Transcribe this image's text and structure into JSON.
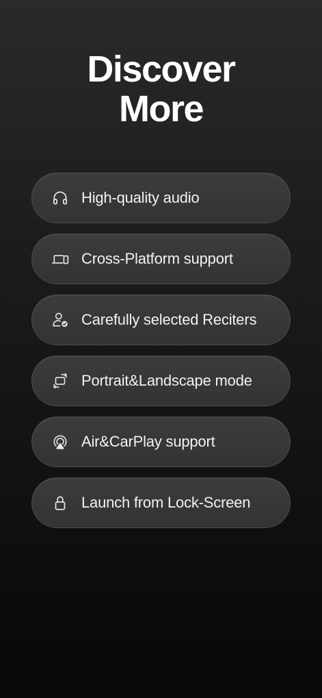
{
  "title": {
    "line1": "Discover",
    "line2": "More"
  },
  "features": [
    {
      "label": "High-quality audio",
      "icon": "headphones-icon"
    },
    {
      "label": "Cross-Platform support",
      "icon": "devices-icon"
    },
    {
      "label": "Carefully selected Reciters",
      "icon": "verified-person-icon"
    },
    {
      "label": "Portrait&Landscape mode",
      "icon": "rotate-screen-icon"
    },
    {
      "label": "Air&CarPlay support",
      "icon": "airplay-icon"
    },
    {
      "label": "Launch from Lock-Screen",
      "icon": "lock-icon"
    }
  ],
  "colors": {
    "background_top": "#2a2a2a",
    "background_bottom": "#080808",
    "pill": "#363636",
    "text": "#f2f2f2"
  }
}
